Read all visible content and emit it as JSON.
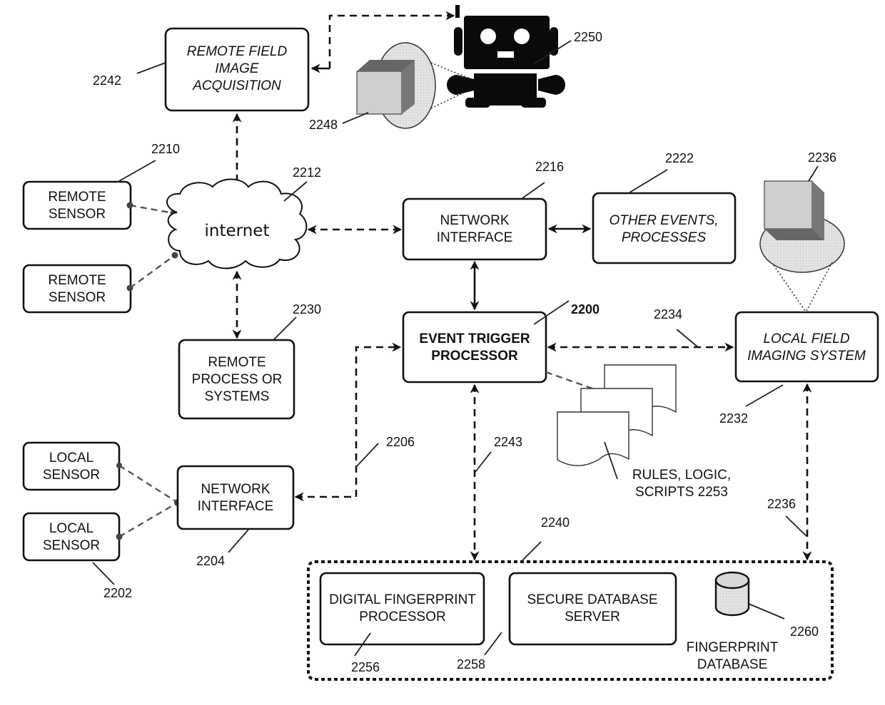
{
  "diagram": {
    "remote_field_image_acquisition": {
      "lines": [
        "REMOTE FIELD",
        "IMAGE",
        "ACQUISITION"
      ],
      "ref": "2242"
    },
    "robot": {
      "ref": "2250"
    },
    "remote_camera": {
      "ref": "2248"
    },
    "remote_sensor_1": {
      "lines": [
        "REMOTE",
        "SENSOR"
      ],
      "ref": "2210"
    },
    "remote_sensor_2": {
      "lines": [
        "REMOTE",
        "SENSOR"
      ]
    },
    "internet": {
      "label": "internet",
      "ref": "2212"
    },
    "network_interface_top": {
      "lines": [
        "NETWORK",
        "INTERFACE"
      ],
      "ref": "2216"
    },
    "other_events": {
      "lines": [
        "OTHER EVENTS,",
        "PROCESSES"
      ],
      "ref": "2222"
    },
    "local_camera": {
      "ref": "2236"
    },
    "remote_process": {
      "lines": [
        "REMOTE",
        "PROCESS OR",
        "SYSTEMS"
      ],
      "ref": "2230"
    },
    "event_trigger_processor": {
      "lines": [
        "EVENT TRIGGER",
        "PROCESSOR"
      ],
      "ref": "2200"
    },
    "local_field_imaging": {
      "lines": [
        "LOCAL FIELD",
        "IMAGING SYSTEM"
      ],
      "ref": "2232"
    },
    "link_2234": {
      "ref": "2234"
    },
    "rules": {
      "lines": [
        "RULES, LOGIC,",
        "SCRIPTS 2253"
      ]
    },
    "local_sensor_1": {
      "lines": [
        "LOCAL",
        "SENSOR"
      ]
    },
    "local_sensor_2": {
      "lines": [
        "LOCAL",
        "SENSOR"
      ],
      "ref": "2202"
    },
    "network_interface_bottom": {
      "lines": [
        "NETWORK",
        "INTERFACE"
      ],
      "ref": "2204"
    },
    "link_2206": {
      "ref": "2206"
    },
    "link_2243": {
      "ref": "2243"
    },
    "link_2236": {
      "ref": "2236"
    },
    "secure_group": {
      "ref": "2240"
    },
    "fingerprint_processor": {
      "lines": [
        "DIGITAL FINGERPRINT",
        "PROCESSOR"
      ],
      "ref": "2256"
    },
    "secure_db_server": {
      "lines": [
        "SECURE DATABASE",
        "SERVER"
      ],
      "ref": "2258"
    },
    "fingerprint_db": {
      "lines": [
        "FINGERPRINT",
        "DATABASE"
      ],
      "ref": "2260"
    }
  }
}
